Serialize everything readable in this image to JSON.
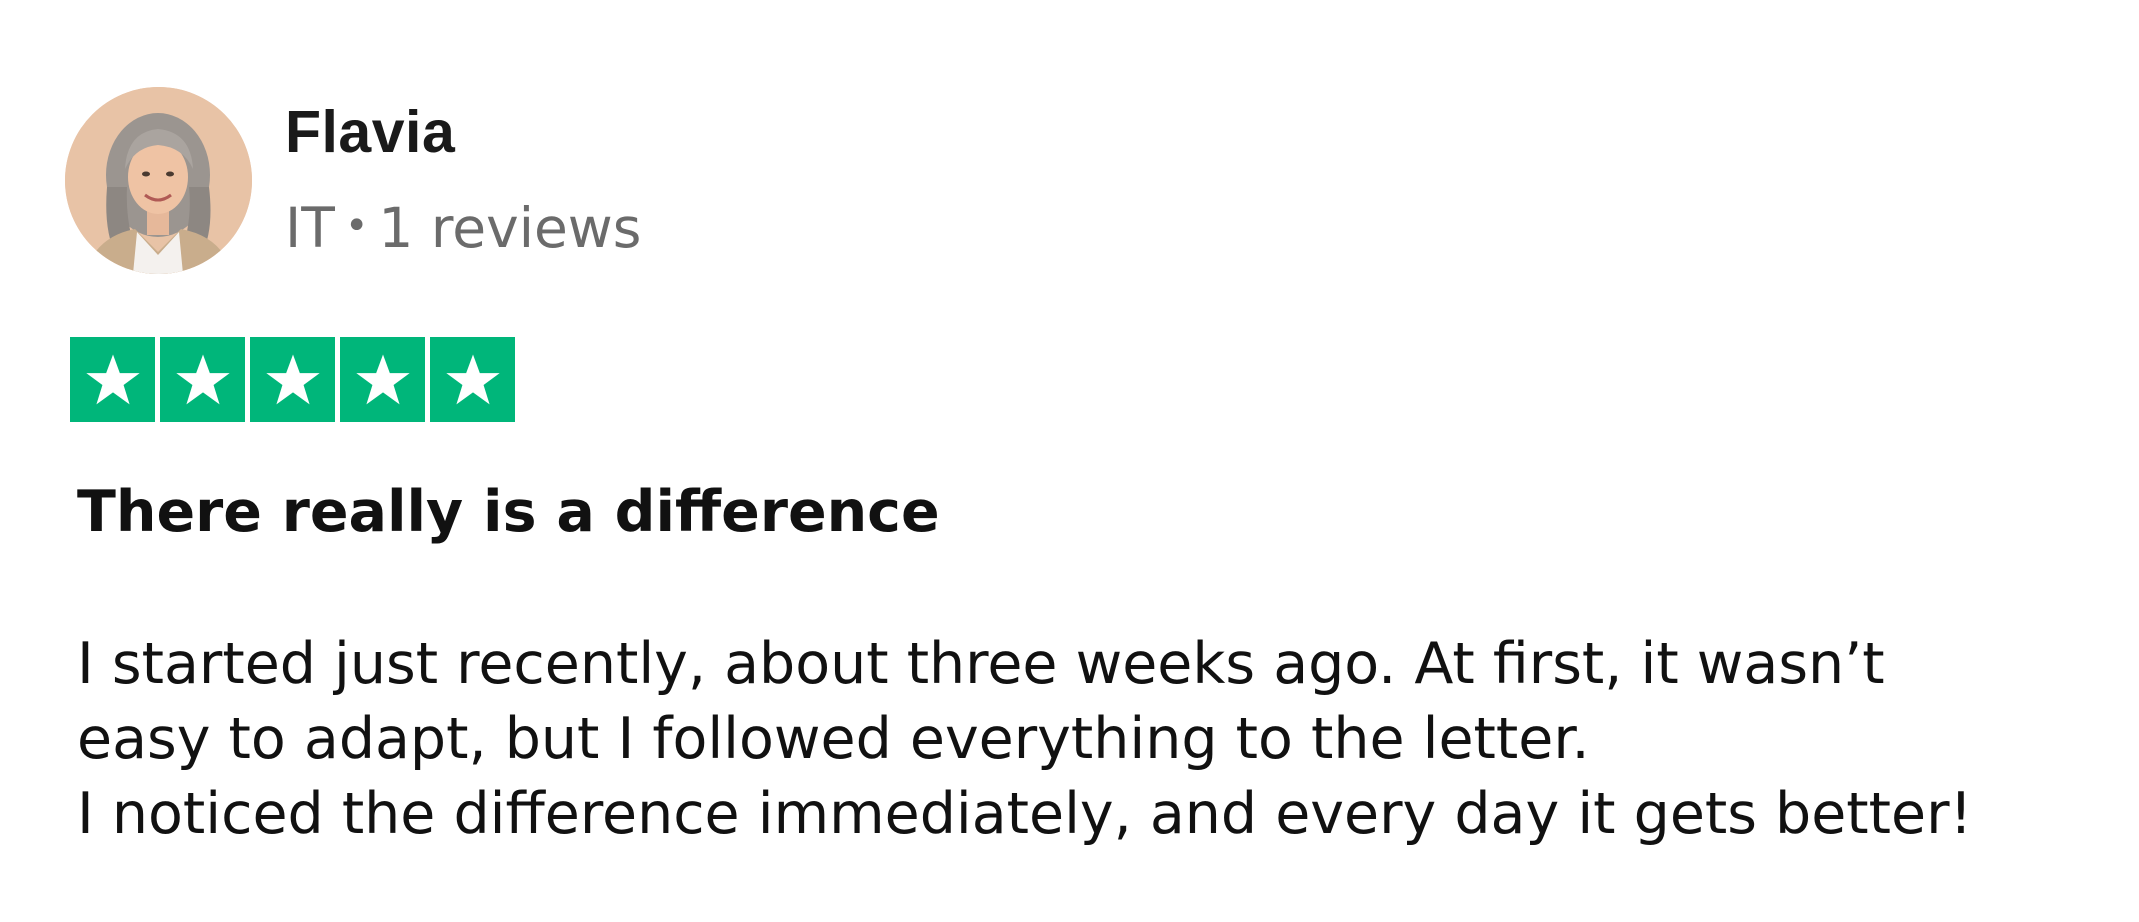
{
  "reviewer": {
    "name": "Flavia",
    "country": "IT",
    "separator": "•",
    "reviews_count": "1 reviews",
    "avatar_icon": "profile-photo-woman-gray-hair"
  },
  "rating": {
    "stars": 5,
    "max_stars": 5,
    "star_color": "#00b67a",
    "star_icon": "star-icon"
  },
  "review": {
    "title": "There really is a difference",
    "body_lines": [
      "I started just recently, about three weeks ago. At first, it wasn’t",
      "easy to adapt, but I followed everything to the letter.",
      "I noticed the difference immediately, and every day it gets better!"
    ]
  }
}
